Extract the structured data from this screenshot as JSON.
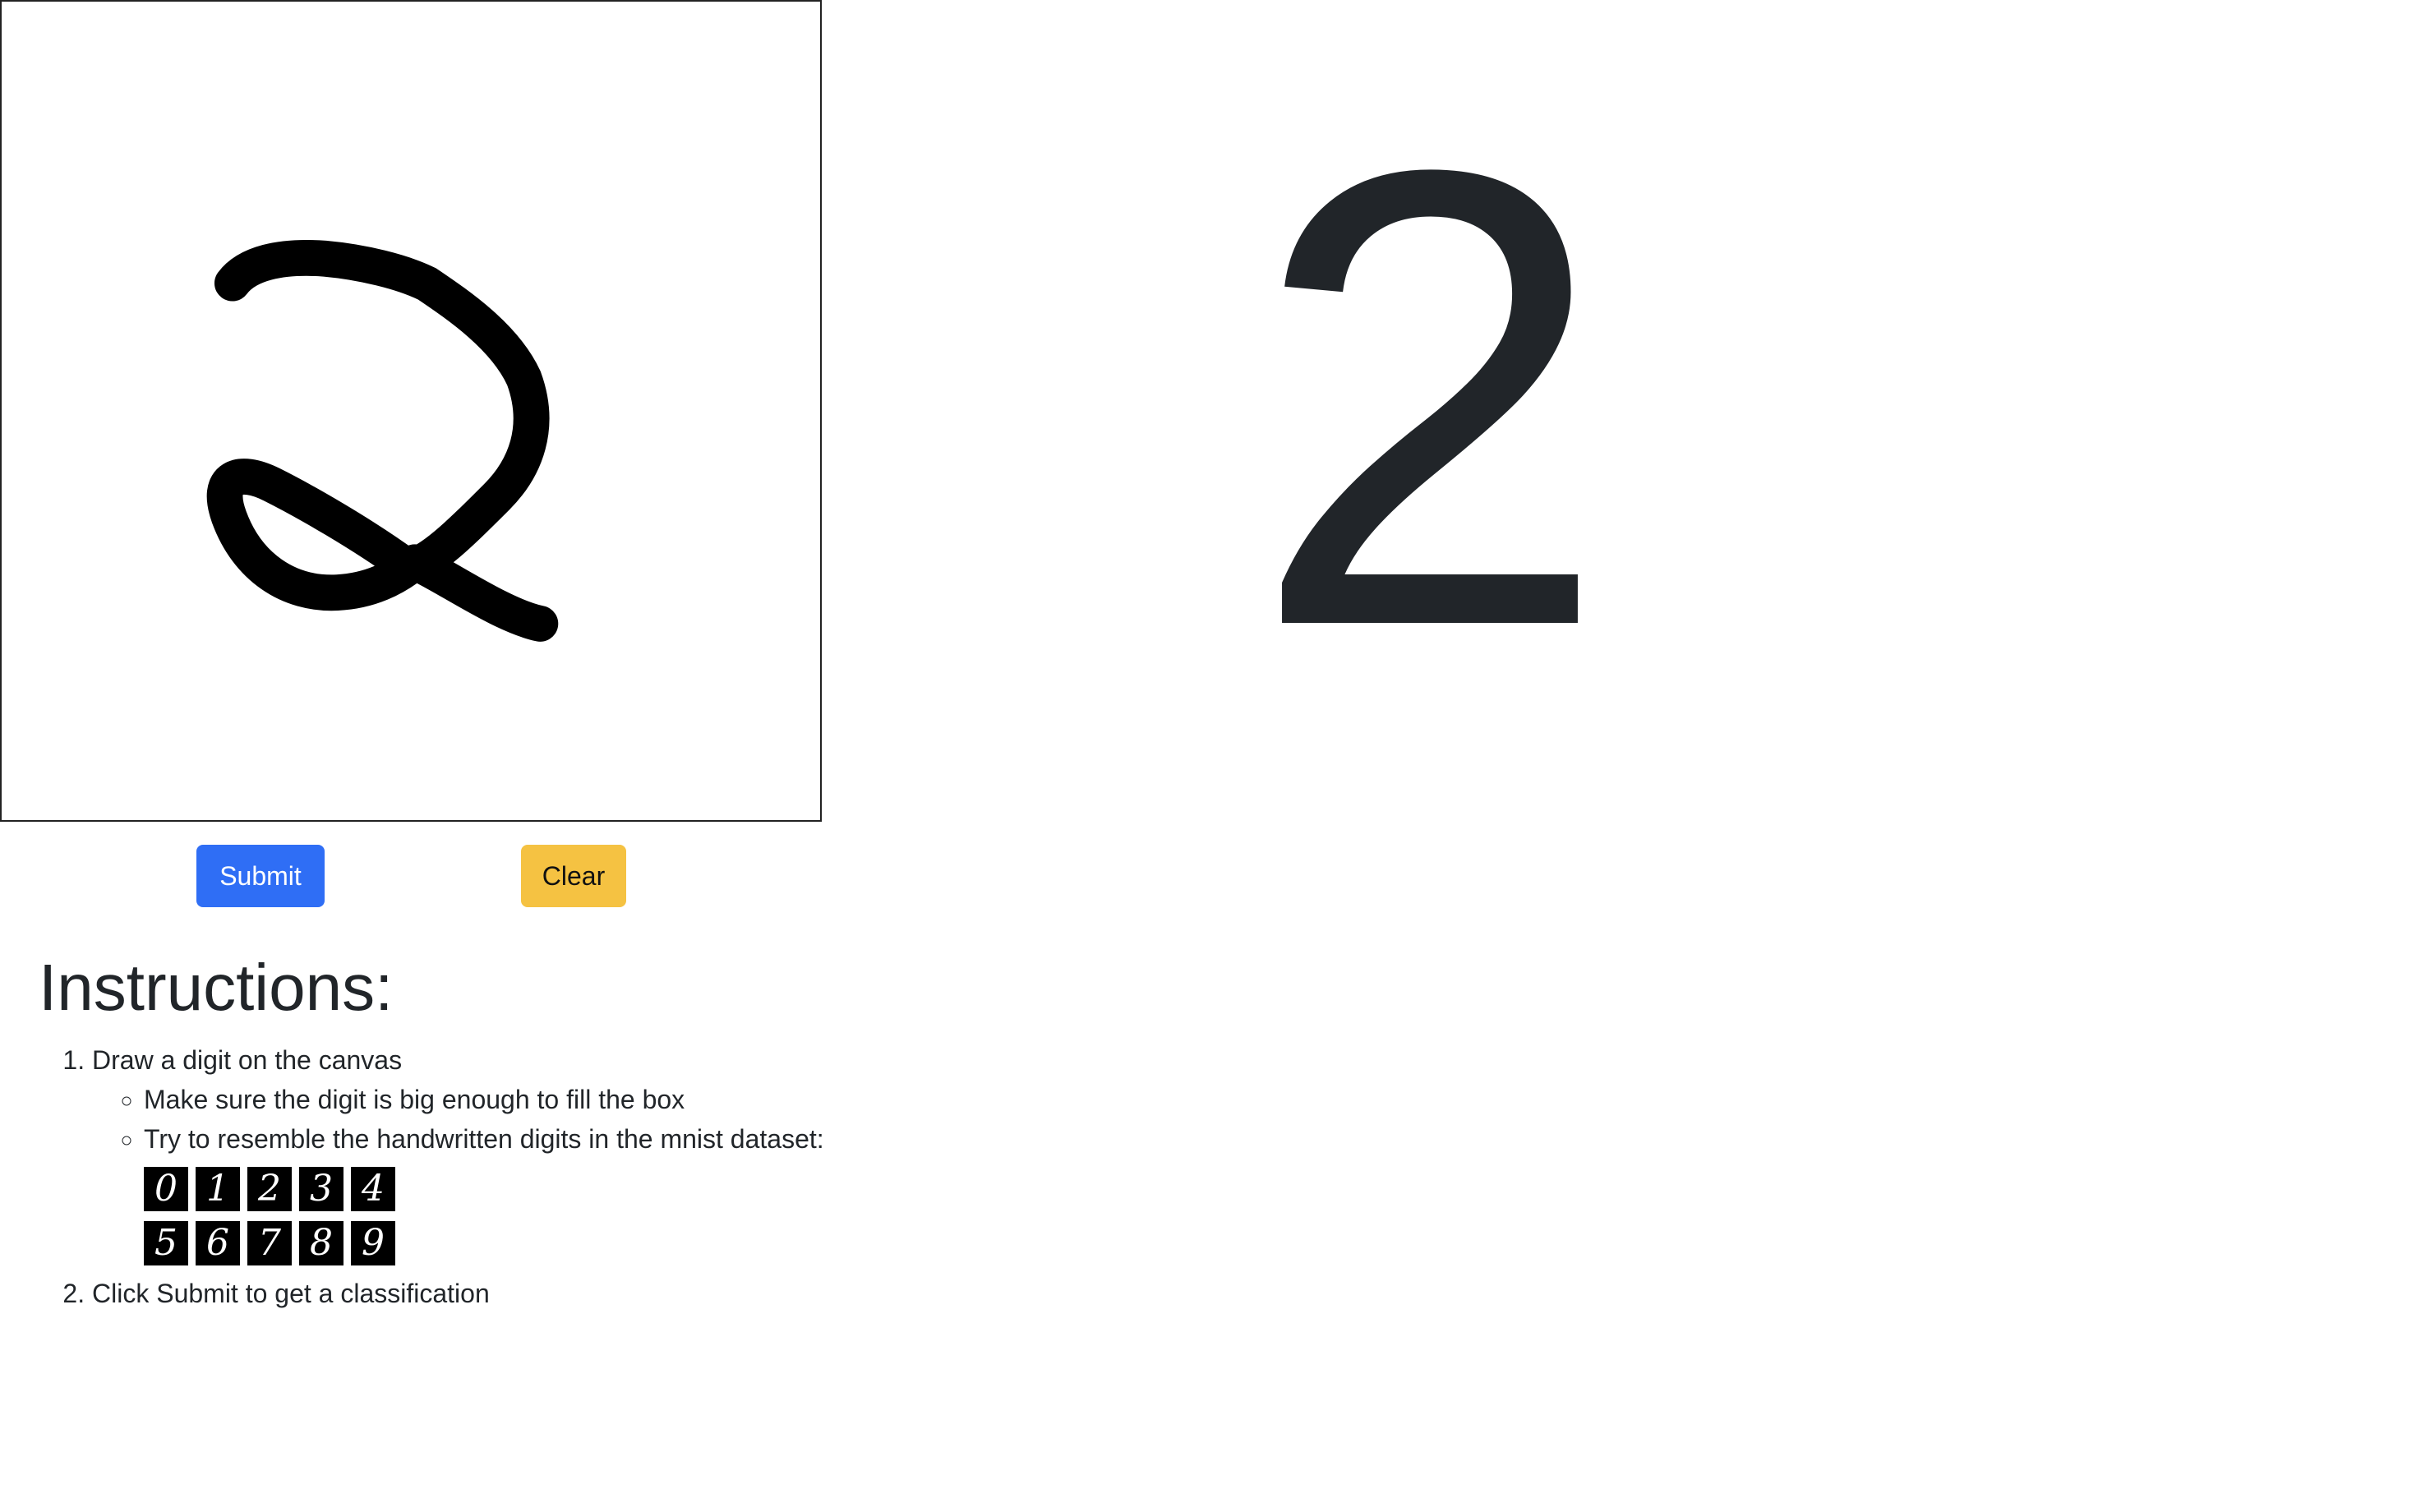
{
  "canvas": {
    "drawn_digit_description": "handwritten-2-stroke"
  },
  "buttons": {
    "submit_label": "Submit",
    "clear_label": "Clear"
  },
  "colors": {
    "submit": "#2f6ef5",
    "clear": "#f5c242",
    "prediction_text": "#212529"
  },
  "prediction": {
    "value": "2"
  },
  "instructions": {
    "heading": "Instructions:",
    "steps": [
      {
        "text": "Draw a digit on the canvas",
        "subitems": [
          "Make sure the digit is big enough to fill the box",
          "Try to resemble the handwritten digits in the mnist dataset:"
        ]
      },
      {
        "text": "Click Submit to get a classification"
      }
    ],
    "mnist_examples": [
      "0",
      "1",
      "2",
      "3",
      "4",
      "5",
      "6",
      "7",
      "8",
      "9"
    ]
  }
}
